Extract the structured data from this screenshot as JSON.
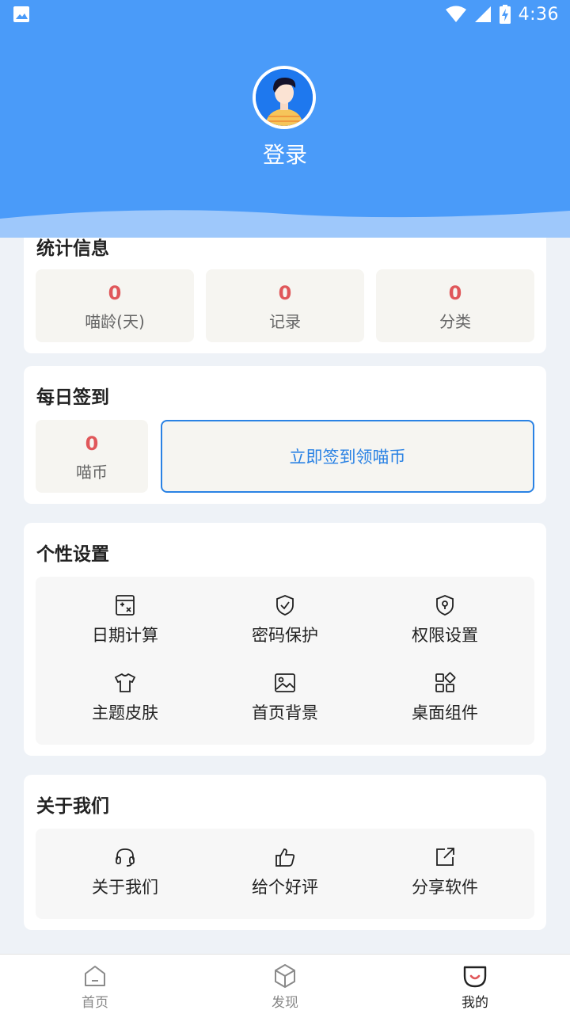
{
  "status_bar": {
    "time": "4:36"
  },
  "header": {
    "login_label": "登录"
  },
  "stats": {
    "title": "统计信息",
    "items": [
      {
        "value": "0",
        "label": "喵龄(天)"
      },
      {
        "value": "0",
        "label": "记录"
      },
      {
        "value": "0",
        "label": "分类"
      }
    ]
  },
  "checkin": {
    "title": "每日签到",
    "coins_value": "0",
    "coins_label": "喵币",
    "button_label": "立即签到领喵币"
  },
  "settings": {
    "title": "个性设置",
    "items": [
      {
        "label": "日期计算",
        "icon": "calculator-icon"
      },
      {
        "label": "密码保护",
        "icon": "shield-check-icon"
      },
      {
        "label": "权限设置",
        "icon": "shield-lock-icon"
      },
      {
        "label": "主题皮肤",
        "icon": "tshirt-icon"
      },
      {
        "label": "首页背景",
        "icon": "image-icon"
      },
      {
        "label": "桌面组件",
        "icon": "widgets-icon"
      }
    ]
  },
  "about": {
    "title": "关于我们",
    "items": [
      {
        "label": "关于我们",
        "icon": "headset-icon"
      },
      {
        "label": "给个好评",
        "icon": "thumbs-up-icon"
      },
      {
        "label": "分享软件",
        "icon": "share-external-icon"
      }
    ]
  },
  "bottom_nav": {
    "items": [
      {
        "label": "首页",
        "icon": "home-icon",
        "active": false
      },
      {
        "label": "发现",
        "icon": "discover-cube-icon",
        "active": false
      },
      {
        "label": "我的",
        "icon": "profile-smile-icon",
        "active": true
      }
    ]
  },
  "colors": {
    "primary": "#4a9bf9",
    "accent_blue": "#2a82e4",
    "stat_red": "#e0575a"
  }
}
